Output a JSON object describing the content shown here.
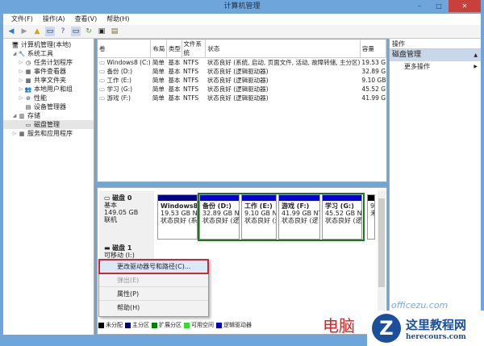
{
  "window": {
    "title": "计算机管理",
    "minimize": "–",
    "maximize": "□",
    "close": "✕"
  },
  "menu": [
    "文件(F)",
    "操作(A)",
    "查看(V)",
    "帮助(H)"
  ],
  "tree": [
    {
      "label": "计算机管理(本地)",
      "level": 0,
      "expander": ""
    },
    {
      "label": "系统工具",
      "level": 1,
      "expander": "◢"
    },
    {
      "label": "任务计划程序",
      "level": 2,
      "expander": "▷"
    },
    {
      "label": "事件查看器",
      "level": 2,
      "expander": "▷"
    },
    {
      "label": "共享文件夹",
      "level": 2,
      "expander": "▷"
    },
    {
      "label": "本地用户和组",
      "level": 2,
      "expander": "▷"
    },
    {
      "label": "性能",
      "level": 2,
      "expander": "▷"
    },
    {
      "label": "设备管理器",
      "level": 2,
      "expander": ""
    },
    {
      "label": "存储",
      "level": 1,
      "expander": "◢"
    },
    {
      "label": "磁盘管理",
      "level": 2,
      "expander": "",
      "selected": true
    },
    {
      "label": "服务和应用程序",
      "level": 1,
      "expander": "▷"
    }
  ],
  "volumes": {
    "columns": [
      "卷",
      "布局",
      "类型",
      "文件系统",
      "状态",
      "容量"
    ],
    "rows": [
      [
        "Windows8 (C:)",
        "简单",
        "基本",
        "NTFS",
        "状态良好 (系统, 启动, 页面文件, 活动, 故障转储, 主分区)",
        "19.53 G"
      ],
      [
        "备份 (D:)",
        "简单",
        "基本",
        "NTFS",
        "状态良好 (逻辑驱动器)",
        "32.89 G"
      ],
      [
        "工作 (E:)",
        "简单",
        "基本",
        "NTFS",
        "状态良好 (逻辑驱动器)",
        "9.10 GB"
      ],
      [
        "学习 (G:)",
        "简单",
        "基本",
        "NTFS",
        "状态良好 (逻辑驱动器)",
        "45.52 G"
      ],
      [
        "游戏 (F:)",
        "简单",
        "基本",
        "NTFS",
        "状态良好 (逻辑驱动器)",
        "41.99 G"
      ]
    ]
  },
  "disk0": {
    "name": "磁盘 0",
    "type": "基本",
    "size": "149.05 GB",
    "state": "联机",
    "partitions": [
      {
        "name": "Windows8",
        "size": "19.53 GB N",
        "status": "状态良好 (系"
      },
      {
        "name": "备份 (D:)",
        "size": "32.89 GB N",
        "status": "状态良好 (逻"
      },
      {
        "name": "工作 (E:)",
        "size": "9.10 GB N",
        "status": "状态良好 (逻"
      },
      {
        "name": "游戏 (F:)",
        "size": "41.99 GB NT",
        "status": "状态良好 (逻"
      },
      {
        "name": "学习 (G:)",
        "size": "45.52 GB NT",
        "status": "状态良好 (逻"
      },
      {
        "name": "",
        "size": "9",
        "status": "未"
      }
    ]
  },
  "disk1": {
    "name": "磁盘 1",
    "type": "可移动 (I:)"
  },
  "context_menu": [
    "更改驱动器号和路径(C)...",
    "弹出(E)",
    "属性(P)",
    "帮助(H)"
  ],
  "legend": [
    {
      "label": "未分配",
      "color": "#000000"
    },
    {
      "label": "主分区",
      "color": "#000080"
    },
    {
      "label": "扩展分区",
      "color": "#008000"
    },
    {
      "label": "可用空间",
      "color": "#33dd33"
    },
    {
      "label": "逻辑驱动器",
      "color": "#0000c0"
    }
  ],
  "actions": {
    "header": "操作",
    "section": "磁盘管理",
    "more": "更多操作"
  },
  "watermark": {
    "site": "officezu.com",
    "red": "电脑",
    "brand": "这里教程网",
    "url": "herecours.com"
  }
}
